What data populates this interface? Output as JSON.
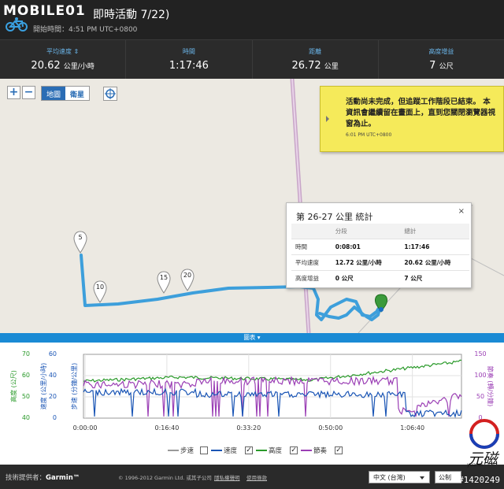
{
  "header": {
    "logo": "MOBILE01",
    "title": "即時活動 7/22)",
    "start_time": "開始時間：4:51 PM UTC+0800"
  },
  "stats": [
    {
      "label": "平均速度 ⇕",
      "value": "20.62",
      "unit": "公里/小時"
    },
    {
      "label": "時間",
      "value": "1:17:46",
      "unit": ""
    },
    {
      "label": "距離",
      "value": "26.72",
      "unit": "公里"
    },
    {
      "label": "高度增益",
      "value": "7",
      "unit": "公尺"
    }
  ],
  "map": {
    "zoom_in": "+",
    "zoom_out": "−",
    "type_map": "地圖",
    "type_satellite": "衛星",
    "markers": [
      "5",
      "10",
      "15",
      "20"
    ],
    "notice": {
      "message": "活動尚未完成，但追蹤工作階段已結束。 本資訊會繼續留在畫面上，直到您關閉瀏覽器視窗為止。",
      "time": "6:01 PM UTC+0800"
    },
    "popup": {
      "title": "第 26-27 公里 統計",
      "close": "×",
      "col_segment": "分段",
      "col_total": "總計",
      "rows": [
        {
          "label": "時間",
          "segment": "0:08:01",
          "total": "1:17:46"
        },
        {
          "label": "平均速度",
          "segment": "12.72 公里/小時",
          "total": "20.62 公里/小時"
        },
        {
          "label": "高度增益",
          "segment": "0 公尺",
          "total": "7 公尺"
        }
      ]
    }
  },
  "chart_tab": "圖表 ▾",
  "chart_data": {
    "type": "line",
    "x_ticks": [
      "0:00:00",
      "0:16:40",
      "0:33:20",
      "0:50:00",
      "1:06:40"
    ],
    "axes": [
      {
        "label": "高度 (公尺)",
        "ticks": [
          "70",
          "60",
          "50",
          "40"
        ],
        "color": "#2a9a2a"
      },
      {
        "label": "速度 (公里/小時)",
        "ticks": [
          "60",
          "40",
          "20",
          "0"
        ],
        "color": "#1a55b5"
      },
      {
        "label": "步速 (分鐘/公里)",
        "ticks": [
          "0",
          "",
          "",
          ""
        ],
        "color": "#1a55b5"
      },
      {
        "label": "節奏 (轉/分鐘)",
        "ticks": [
          "150",
          "100",
          "50",
          "0"
        ],
        "color": "#9b3fb5"
      }
    ],
    "legend": [
      {
        "name": "步速",
        "color": "#999999",
        "checked": false
      },
      {
        "name": "速度",
        "color": "#1a55b5",
        "checked": true
      },
      {
        "name": "高度",
        "color": "#2a9a2a",
        "checked": true
      },
      {
        "name": "節奏",
        "color": "#9b3fb5",
        "checked": true
      }
    ]
  },
  "footer": {
    "provider_label": "技術提供者：",
    "provider": "Garmin™",
    "copyright": "© 1996-2012 Garmin Ltd. 或其子公司",
    "link1": "隱私權聲明",
    "link2": "使用條款",
    "language": "中文 (台灣)",
    "unit_btn": "公制"
  },
  "watermark": {
    "text": "元磁",
    "sub": "yuanci",
    "tag": "#1420249"
  },
  "colors": {
    "accent": "#1a8ad4",
    "track": "#3d9fdb",
    "notice": "#f5ea5a"
  }
}
